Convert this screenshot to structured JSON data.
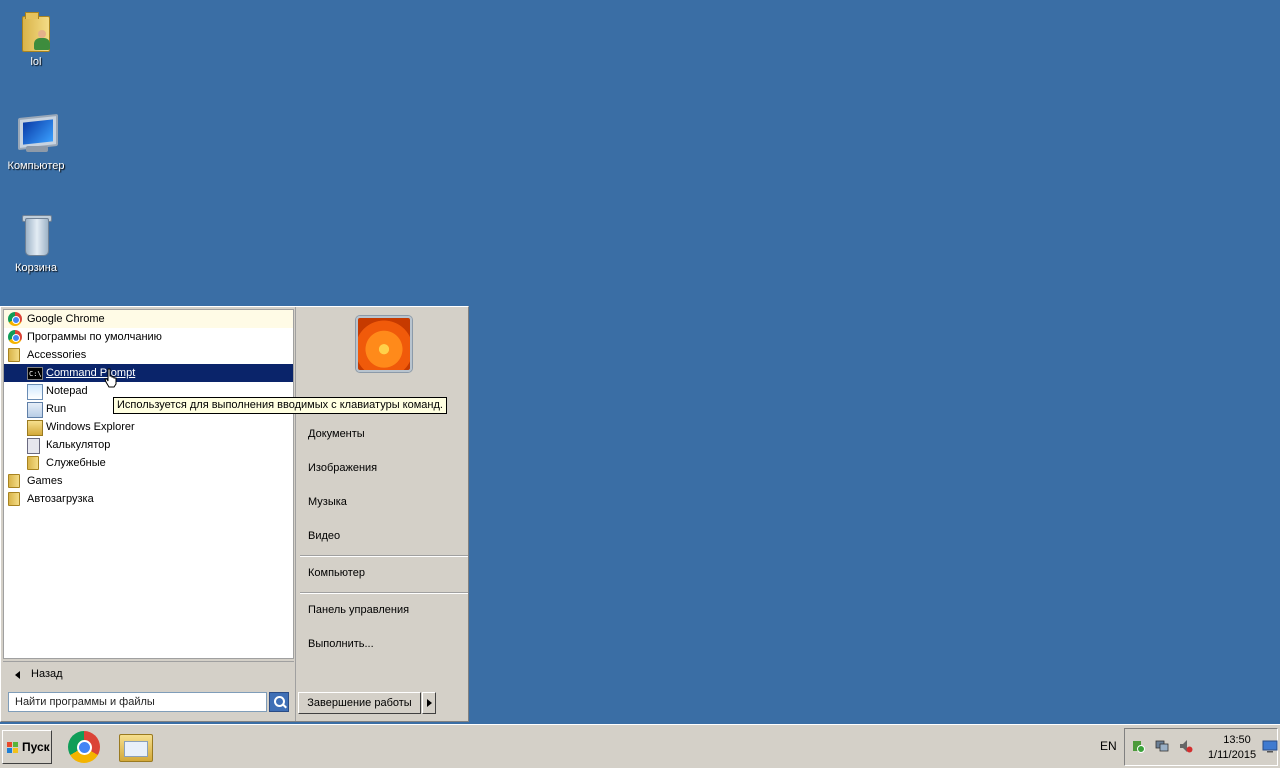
{
  "desktop": {
    "icons": [
      {
        "label": "lol",
        "icon": "user-folder-icon"
      },
      {
        "label": "Компьютер",
        "icon": "computer-icon"
      },
      {
        "label": "Корзина",
        "icon": "recycle-bin-icon"
      }
    ]
  },
  "start_menu": {
    "programs": [
      {
        "label": "Google Chrome",
        "icon": "chrome-icon",
        "level": 0
      },
      {
        "label": "Программы по умолчанию",
        "icon": "default-programs-icon",
        "level": 0
      },
      {
        "label": "Accessories",
        "icon": "folder-icon",
        "level": 0
      },
      {
        "label": "Command Prompt",
        "icon": "command-prompt-icon",
        "level": 1,
        "selected": true
      },
      {
        "label": "Notepad",
        "icon": "notepad-icon",
        "level": 1
      },
      {
        "label": "Run",
        "icon": "run-icon",
        "level": 1
      },
      {
        "label": "Windows Explorer",
        "icon": "explorer-icon",
        "level": 1
      },
      {
        "label": "Калькулятор",
        "icon": "calculator-icon",
        "level": 1
      },
      {
        "label": "Служебные",
        "icon": "folder-icon",
        "level": 1
      },
      {
        "label": "Games",
        "icon": "folder-icon",
        "level": 0
      },
      {
        "label": "Автозагрузка",
        "icon": "folder-icon",
        "level": 0
      }
    ],
    "back_label": "Назад",
    "search_placeholder": "Найти программы и файлы",
    "tooltip": "Используется для выполнения вводимых с клавиатуры команд.",
    "right_items": {
      "documents": "Документы",
      "pictures": "Изображения",
      "music": "Музыка",
      "video": "Видео",
      "computer": "Компьютер",
      "control_panel": "Панель управления",
      "run": "Выполнить..."
    },
    "shutdown_label": "Завершение работы"
  },
  "taskbar": {
    "start_label": "Пуск",
    "language": "EN",
    "time": "13:50",
    "date": "1/11/2015"
  },
  "colors": {
    "desktop_background": "#3a6ea5",
    "selection": "#0a246a",
    "tooltip_background": "#ffffe1"
  }
}
